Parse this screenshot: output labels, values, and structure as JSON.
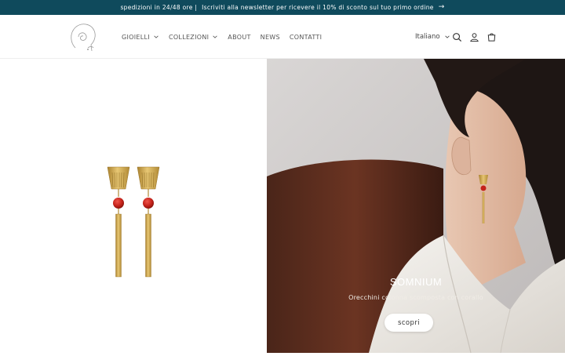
{
  "announcement": {
    "shipping_text": "spedizioni in 24/48 ore |",
    "newsletter_text": "Iscriviti alla newsletter per ricevere il 10% di sconto sul tuo primo ordine",
    "arrow": "→"
  },
  "header": {
    "nav": [
      {
        "label": "GIOIELLI",
        "has_dropdown": true
      },
      {
        "label": "COLLEZIONI",
        "has_dropdown": true
      },
      {
        "label": "ABOUT",
        "has_dropdown": false
      },
      {
        "label": "NEWS",
        "has_dropdown": false
      },
      {
        "label": "CONTATTI",
        "has_dropdown": false
      }
    ],
    "language": "Italiano",
    "icons": [
      "search-icon",
      "account-icon",
      "cart-icon"
    ]
  },
  "hero": {
    "title": "SOMNIUM",
    "subtitle": "Orecchini colonna scomposta con corallo",
    "cta_label": "scopri"
  },
  "colors": {
    "announcement_bg": "#0f4a5c",
    "gold": "#c9a24a",
    "coral": "#c0281e"
  }
}
